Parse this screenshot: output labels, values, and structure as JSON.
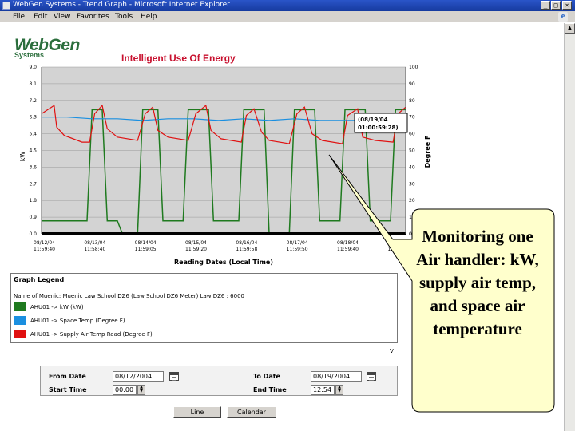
{
  "window": {
    "title": "WebGen Systems - Trend Graph - Microsoft Internet Explorer",
    "controls": {
      "minimize": "_",
      "maximize": "□",
      "close": "×"
    }
  },
  "menu": [
    "File",
    "Edit",
    "View",
    "Favorites",
    "Tools",
    "Help"
  ],
  "brand": {
    "name": "WebGen",
    "sub": "Systems",
    "color": "#2b6e3c"
  },
  "page": {
    "title": "Intelligent Use Of Energy",
    "title_color": "#c8102e"
  },
  "chart_data": {
    "type": "line",
    "ylabel_left": "kW",
    "ylabel_right": "Degree F",
    "xlabel": "Reading Dates (Local Time)",
    "y_left_ticks": [
      "9.0",
      "8.1",
      "7.2",
      "6.3",
      "5.4",
      "4.5",
      "3.6",
      "2.7",
      "1.8",
      "0.9",
      "0.0"
    ],
    "y_right_ticks": [
      "100",
      "90",
      "80",
      "70",
      "60",
      "50",
      "40",
      "30",
      "20",
      "10",
      "0"
    ],
    "ylim_left": [
      0,
      9
    ],
    "ylim_right": [
      0,
      100
    ],
    "x_ticks": [
      [
        "08/12/04",
        "11:59:40"
      ],
      [
        "08/13/04",
        "11:58:40"
      ],
      [
        "08/14/04",
        "11:59:05"
      ],
      [
        "08/15/04",
        "11:59:20"
      ],
      [
        "08/16/04",
        "11:59:58"
      ],
      [
        "08/17/04",
        "11:59:50"
      ],
      [
        "08/18/04",
        "11:59:40"
      ],
      [
        "08/19/04",
        "11:59:40"
      ]
    ],
    "background": "#d3d3d3",
    "grid": true,
    "tooltip": [
      "(08/19/04",
      "01:00:59:28)"
    ],
    "series": [
      {
        "color": "#1f7a1f",
        "axis": "left",
        "points": [
          [
            0,
            0.7
          ],
          [
            0.9,
            0.7
          ],
          [
            1.0,
            6.7
          ],
          [
            1.2,
            6.7
          ],
          [
            1.3,
            0.7
          ],
          [
            1.5,
            0.7
          ],
          [
            1.6,
            0.0
          ],
          [
            1.9,
            0.0
          ],
          [
            2.0,
            6.7
          ],
          [
            2.3,
            6.7
          ],
          [
            2.4,
            0.7
          ],
          [
            2.8,
            0.7
          ],
          [
            2.9,
            6.7
          ],
          [
            3.3,
            6.7
          ],
          [
            3.4,
            0.7
          ],
          [
            3.9,
            0.7
          ],
          [
            4.0,
            6.7
          ],
          [
            4.4,
            6.7
          ],
          [
            4.5,
            0.0
          ],
          [
            4.9,
            0.0
          ],
          [
            5.0,
            6.7
          ],
          [
            5.4,
            6.7
          ],
          [
            5.5,
            0.7
          ],
          [
            5.9,
            0.7
          ],
          [
            6.0,
            6.7
          ],
          [
            6.4,
            6.7
          ],
          [
            6.5,
            0.7
          ],
          [
            6.9,
            0.7
          ],
          [
            7.0,
            6.7
          ],
          [
            7.2,
            6.7
          ]
        ]
      },
      {
        "color": "#1a8fe0",
        "axis": "right",
        "points": [
          [
            0.0,
            70
          ],
          [
            0.5,
            70
          ],
          [
            1.0,
            69
          ],
          [
            1.5,
            69
          ],
          [
            2.0,
            68
          ],
          [
            2.5,
            69
          ],
          [
            3.0,
            69
          ],
          [
            3.5,
            68
          ],
          [
            4.0,
            69
          ],
          [
            4.5,
            68
          ],
          [
            5.0,
            69
          ],
          [
            5.5,
            68
          ],
          [
            6.0,
            68
          ],
          [
            6.5,
            68
          ],
          [
            7.0,
            69
          ],
          [
            7.2,
            69
          ]
        ]
      },
      {
        "color": "#e01010",
        "axis": "right",
        "points": [
          [
            0.0,
            72
          ],
          [
            0.25,
            77
          ],
          [
            0.3,
            64
          ],
          [
            0.45,
            59
          ],
          [
            0.8,
            55
          ],
          [
            0.95,
            55
          ],
          [
            1.05,
            72
          ],
          [
            1.2,
            77
          ],
          [
            1.3,
            63
          ],
          [
            1.5,
            58
          ],
          [
            1.9,
            56
          ],
          [
            2.05,
            72
          ],
          [
            2.2,
            76
          ],
          [
            2.3,
            62
          ],
          [
            2.5,
            58
          ],
          [
            2.9,
            56
          ],
          [
            3.05,
            72
          ],
          [
            3.25,
            77
          ],
          [
            3.35,
            62
          ],
          [
            3.55,
            57
          ],
          [
            3.95,
            55
          ],
          [
            4.05,
            71
          ],
          [
            4.2,
            75
          ],
          [
            4.35,
            61
          ],
          [
            4.5,
            56
          ],
          [
            4.9,
            54
          ],
          [
            5.05,
            72
          ],
          [
            5.2,
            76
          ],
          [
            5.35,
            60
          ],
          [
            5.55,
            56
          ],
          [
            5.95,
            54
          ],
          [
            6.05,
            71
          ],
          [
            6.25,
            75
          ],
          [
            6.35,
            58
          ],
          [
            6.6,
            56
          ],
          [
            6.95,
            55
          ],
          [
            7.05,
            72
          ],
          [
            7.2,
            76
          ]
        ]
      }
    ]
  },
  "legend": {
    "title": "Graph Legend",
    "description": "Name of Muenic: Muenic Law School DZ6 (Law School DZ6 Meter) Law DZ6 : 6000",
    "entries": [
      {
        "label": "AHU01 -> kW (kW)",
        "color": "#1f7a1f"
      },
      {
        "label": "AHU01 -> Space Temp (Degree F)",
        "color": "#1a8fe0"
      },
      {
        "label": "AHU01 -> Supply Air Temp Read (Degree F)",
        "color": "#e01010"
      }
    ]
  },
  "partial_text": "V",
  "form": {
    "from_date_label": "From Date",
    "from_date_value": "08/12/2004",
    "to_date_label": "To Date",
    "to_date_value": "08/19/2004",
    "start_time_label": "Start Time",
    "start_time_value": "00:00",
    "end_time_label": "End Time",
    "end_time_value": "12:54",
    "line_button": "Line",
    "calendar_button": "Calendar"
  },
  "callout": {
    "text": "Monitoring one Air handler: kW, supply air temp, and space air temperature"
  }
}
